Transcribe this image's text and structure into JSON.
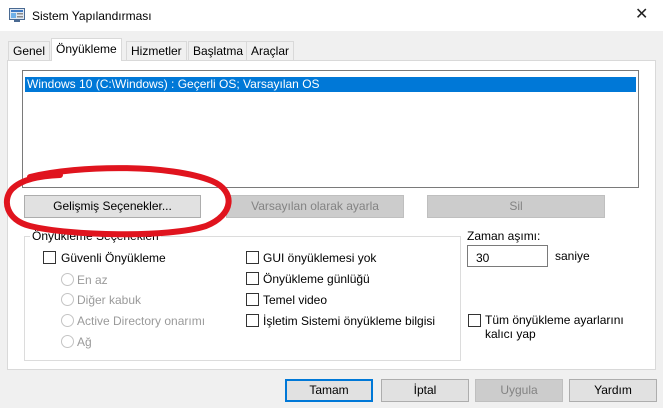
{
  "window": {
    "title": "Sistem Yapılandırması",
    "close_glyph": "✕"
  },
  "tabs": [
    {
      "label": "Genel",
      "active": false
    },
    {
      "label": "Önyükleme",
      "active": true
    },
    {
      "label": "Hizmetler",
      "active": false
    },
    {
      "label": "Başlatma",
      "active": false
    },
    {
      "label": "Araçlar",
      "active": false
    }
  ],
  "boot_list": {
    "selected_entry": "Windows 10 (C:\\Windows) : Geçerli OS; Varsayılan OS"
  },
  "boot_buttons": {
    "advanced": "Gelişmiş Seçenekler...",
    "set_default": "Varsayılan olarak ayarla",
    "delete": "Sil"
  },
  "boot_options": {
    "group_label": "Önyükleme Seçenekleri",
    "safe_boot": {
      "label": "Güvenli Önyükleme",
      "checked": false
    },
    "safe_modes": [
      "En az",
      "Diğer kabuk",
      "Active Directory onarımı",
      "Ağ"
    ],
    "no_gui": {
      "label": "GUI önyüklemesi yok",
      "checked": false
    },
    "boot_log": {
      "label": "Önyükleme günlüğü",
      "checked": false
    },
    "base_video": {
      "label": "Temel video",
      "checked": false
    },
    "os_boot_info": {
      "label": "İşletim Sistemi önyükleme bilgisi",
      "checked": false
    }
  },
  "timeout": {
    "label": "Zaman aşımı:",
    "value": "30",
    "unit": "saniye"
  },
  "permanent": {
    "label_line1": "Tüm önyükleme ayarlarını",
    "label_line2": "kalıcı yap",
    "checked": false
  },
  "footer": {
    "ok": "Tamam",
    "cancel": "İptal",
    "apply": "Uygula",
    "help": "Yardım"
  },
  "colors": {
    "selection": "#0078d7",
    "annotation_circle": "#e0141e",
    "window_bg": "#f0f0f0"
  },
  "icons": {
    "app": "msconfig-icon",
    "close": "close-icon"
  }
}
